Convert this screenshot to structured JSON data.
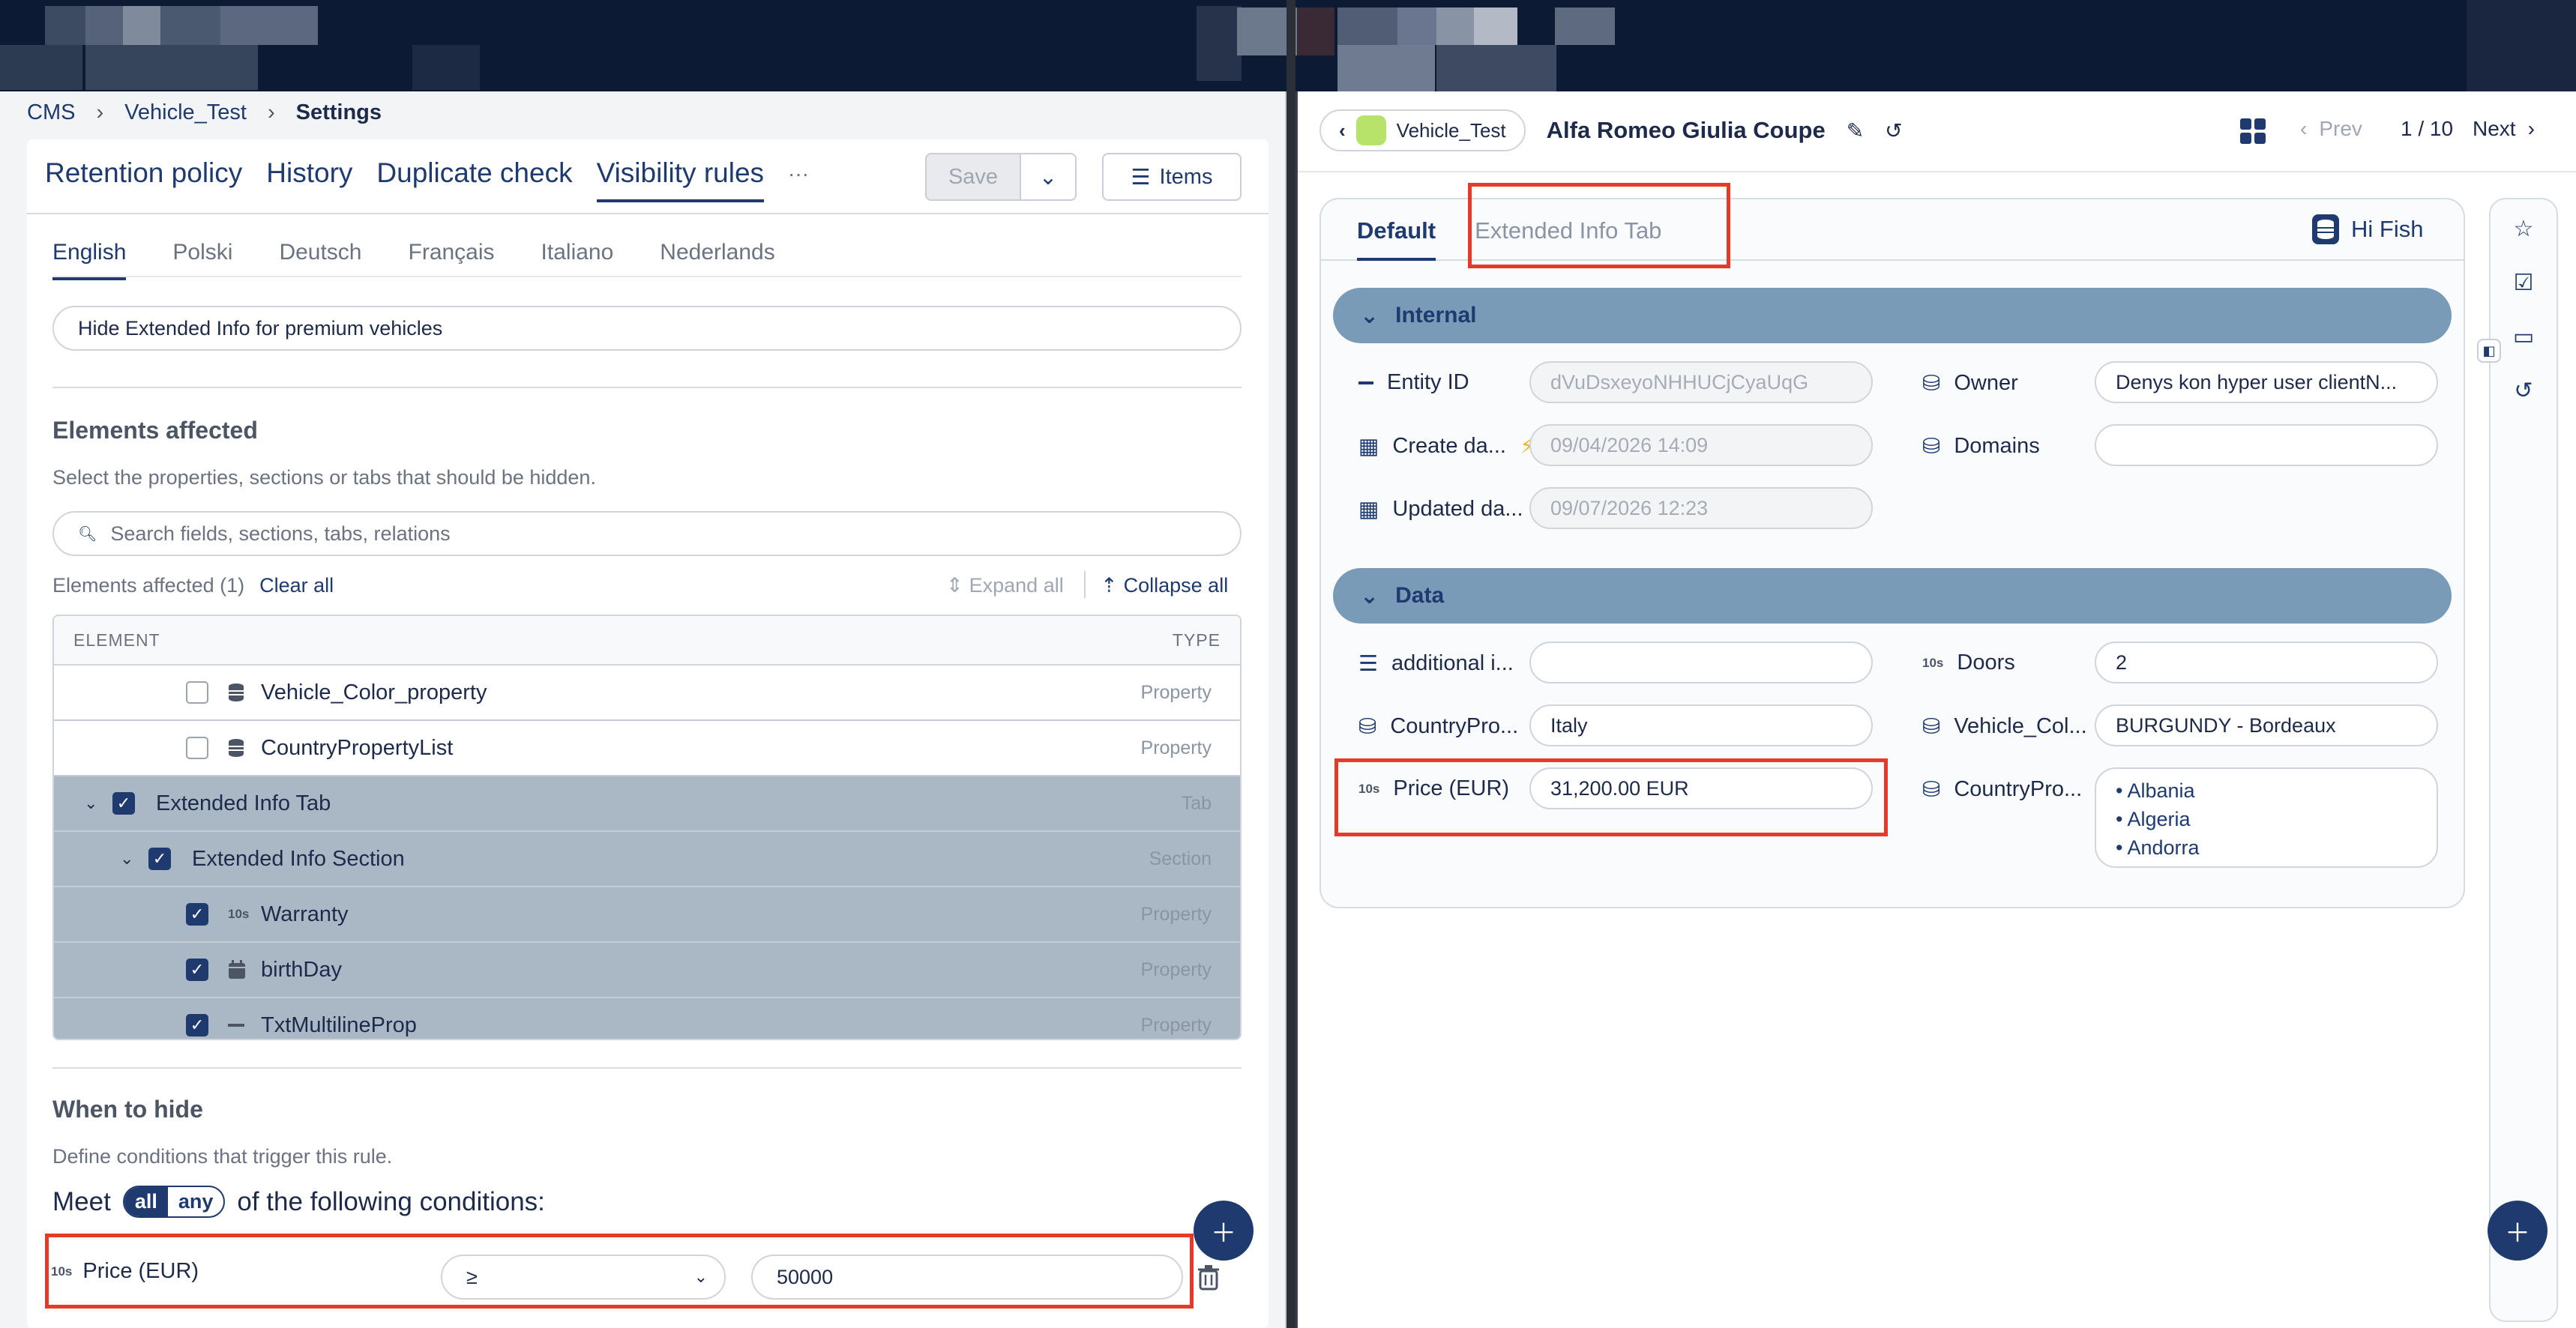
{
  "breadcrumb": {
    "cms": "CMS",
    "entity": "Vehicle_Test",
    "current": "Settings"
  },
  "main_tabs": [
    "Retention policy",
    "History",
    "Duplicate check",
    "Visibility rules",
    "···"
  ],
  "toolbar": {
    "save_label": "Save",
    "items_label": "Items"
  },
  "language_tabs": [
    "English",
    "Polski",
    "Deutsch",
    "Français",
    "Italiano",
    "Nederlands"
  ],
  "rule_name": "Hide Extended Info for premium vehicles",
  "elements_affected": {
    "title": "Elements affected",
    "description": "Select the properties, sections or tabs that should be hidden.",
    "search_placeholder": "Search fields, sections, tabs, relations",
    "count_label": "Elements affected (1)",
    "clear_all": "Clear all",
    "expand_all": "Expand all",
    "collapse_all": "Collapse all",
    "col_element": "ELEMENT",
    "col_type": "TYPE",
    "rows": [
      {
        "label": "Vehicle_Color_property",
        "type": "Property",
        "checked": false,
        "icon": "database-icon"
      },
      {
        "label": "CountryPropertyList",
        "type": "Property",
        "checked": false,
        "icon": "database-icon"
      },
      {
        "label": "Extended Info Tab",
        "type": "Tab",
        "checked": true,
        "icon": ""
      },
      {
        "label": "Extended Info Section",
        "type": "Section",
        "checked": true,
        "icon": ""
      },
      {
        "label": "Warranty",
        "type": "Property",
        "checked": true,
        "icon": "number-icon"
      },
      {
        "label": "birthDay",
        "type": "Property",
        "checked": true,
        "icon": "calendar-icon"
      },
      {
        "label": "TxtMultilineProp",
        "type": "Property",
        "checked": true,
        "icon": "text-icon"
      }
    ]
  },
  "when_to_hide": {
    "title": "When to hide",
    "description": "Define conditions that trigger this rule.",
    "meet_prefix": "Meet",
    "meet_all": "all",
    "meet_any": "any",
    "meet_suffix": "of the following conditions:",
    "condition": {
      "tag": "10s",
      "field": "Price (EUR)",
      "operator": "≥",
      "value": "50000"
    }
  },
  "right": {
    "entity_chip": "Vehicle_Test",
    "title": "Alfa Romeo Giulia Coupe",
    "prev": "Prev",
    "page": "1 / 10",
    "next": "Next",
    "tabs": {
      "default": "Default",
      "extended": "Extended Info Tab",
      "user": "Hi Fish"
    },
    "internal_section": "Internal",
    "data_section": "Data",
    "internal": {
      "entity_id_label": "Entity ID",
      "entity_id_value": "dVuDsxeyoNHHUCjCyaUqG",
      "owner_label": "Owner",
      "owner_value": "Denys kon hyper user clientN...",
      "create_label": "Create da...",
      "create_value": "09/04/2026 14:09",
      "domains_label": "Domains",
      "domains_value": "",
      "updated_label": "Updated da...",
      "updated_value": "09/07/2026 12:23"
    },
    "data": {
      "additional_label": "additional i...",
      "additional_value": "",
      "doors_tag": "10s",
      "doors_label": "Doors",
      "doors_value": "2",
      "countrypro_label": "CountryPro...",
      "countrypro_value": "Italy",
      "vehicle_col_label": "Vehicle_Col...",
      "vehicle_col_value": "BURGUNDY - Bordeaux",
      "price_tag": "10s",
      "price_label": "Price (EUR)",
      "price_value": "31,200.00 EUR",
      "countrypro2_label": "CountryPro...",
      "countries": [
        "Albania",
        "Algeria",
        "Andorra"
      ]
    }
  },
  "colors": {
    "primary": "#1e3a6e",
    "highlight": "#e53a2a",
    "section_bar": "#7a9bb8",
    "selected_row": "#aab8c6"
  }
}
